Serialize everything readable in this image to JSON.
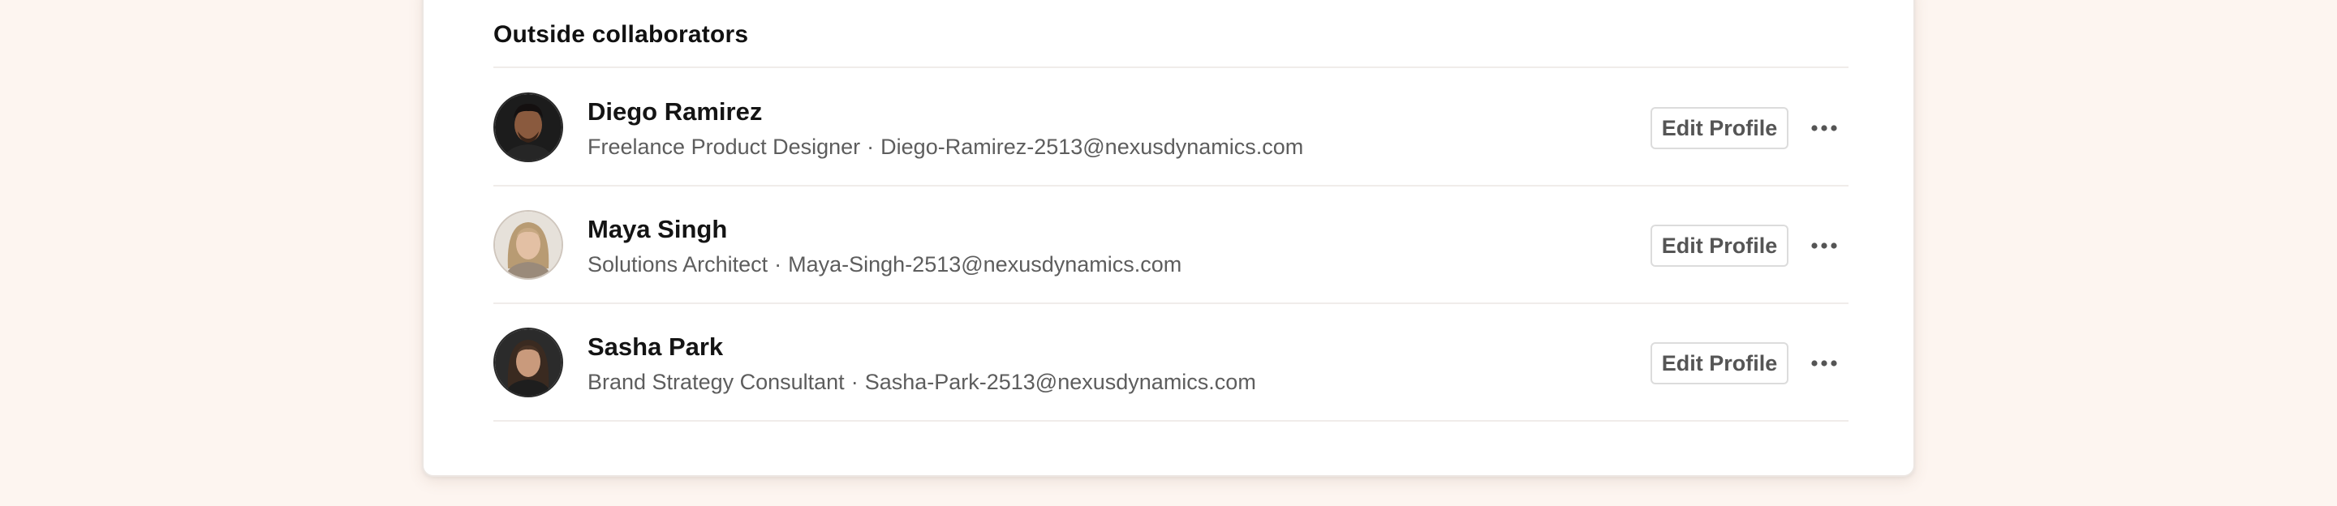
{
  "section": {
    "title": "Outside collaborators"
  },
  "collaborators": [
    {
      "name": "Diego Ramirez",
      "role": "Freelance Product Designer",
      "separator": "·",
      "email": "Diego-Ramirez-2513@nexusdynamics.com",
      "edit_label": "Edit Profile",
      "more_icon": "more-horizontal-icon"
    },
    {
      "name": "Maya Singh",
      "role": "Solutions Architect",
      "separator": "·",
      "email": "Maya-Singh-2513@nexusdynamics.com",
      "edit_label": "Edit Profile",
      "more_icon": "more-horizontal-icon"
    },
    {
      "name": "Sasha Park",
      "role": "Brand Strategy Consultant",
      "separator": "·",
      "email": "Sasha-Park-2513@nexusdynamics.com",
      "edit_label": "Edit Profile",
      "more_icon": "more-horizontal-icon"
    }
  ],
  "colors": {
    "page_background": "#fdf5f0",
    "card_background": "#ffffff",
    "text_primary": "#141414",
    "text_secondary": "#5d5d5d",
    "button_border": "#dcdcdc"
  }
}
